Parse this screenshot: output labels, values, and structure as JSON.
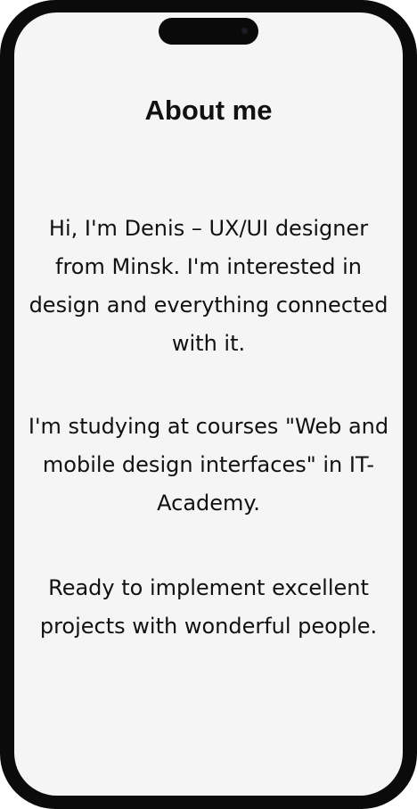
{
  "page": {
    "title": "About me",
    "paragraphs": [
      "Hi, I'm Denis – UX/UI designer from Minsk. I'm interested in design and everything connected with it.",
      "I'm studying at courses \"Web and mobile design interfaces\" in IT-Academy.",
      "Ready to implement excellent projects with wonderful people."
    ]
  },
  "colors": {
    "screen_background": "#f5f5f5",
    "device_frame": "#0b0b0b",
    "text": "#111111"
  }
}
